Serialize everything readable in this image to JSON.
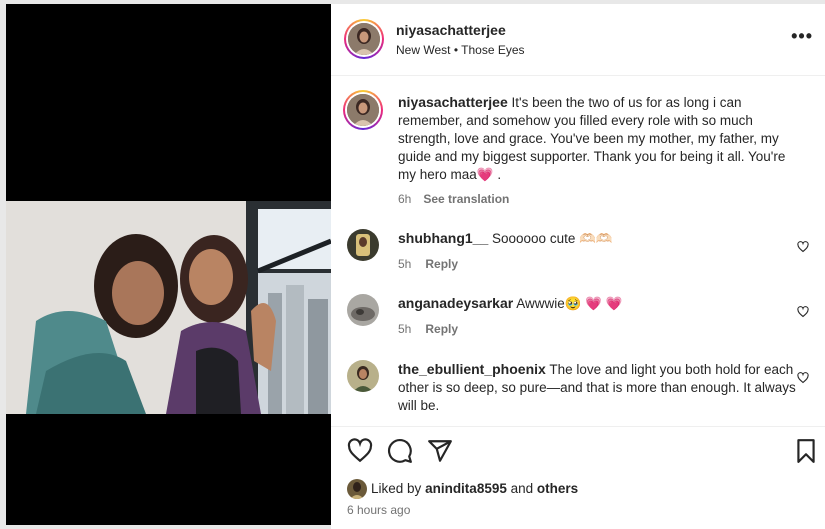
{
  "post": {
    "author": "niyasachatterjee",
    "audio_artist": "New West",
    "audio_separator": "•",
    "audio_track": "Those Eyes",
    "more_icon": "more-horizontal-icon"
  },
  "caption": {
    "author": "niyasachatterjee",
    "text": "It's been the two of us for as long i can remember, and somehow you filled every role with so much strength, love and grace. You've been my mother, my father, my guide and my biggest supporter. Thank you for being it all. You're my hero maa💗 .",
    "time": "6h",
    "see_translation": "See translation"
  },
  "comments": [
    {
      "user": "shubhang1__",
      "text": "Soooooo cute 🫶🏻🫶🏻",
      "time": "5h",
      "reply": "Reply"
    },
    {
      "user": "anganadeysarkar",
      "text": "Awwwie🥹 💗 💗",
      "time": "5h",
      "reply": "Reply"
    },
    {
      "user": "the_ebullient_phoenix",
      "text": "The love and light you both hold for each other is so deep, so pure—and that is more than enough. It always will be.",
      "time": "",
      "reply": ""
    }
  ],
  "likes": {
    "prefix": "Liked by",
    "user": "anindita8595",
    "and": "and",
    "others": "others"
  },
  "posted_ago": "6 hours ago",
  "colors": {
    "text": "#262626",
    "muted": "#737373",
    "ring_start": "#f9ce34",
    "ring_mid": "#ee2a7b",
    "ring_end": "#6228d7"
  }
}
